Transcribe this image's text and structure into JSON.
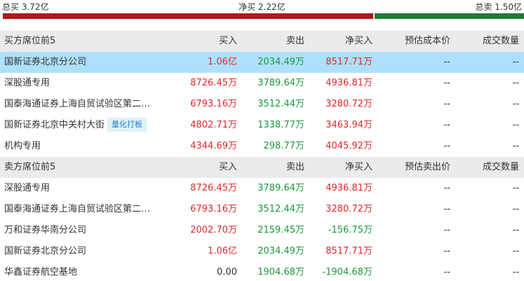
{
  "summary": {
    "total_buy": "总买 3.72亿",
    "net_buy": "净买 2.22亿",
    "total_sell": "总卖 1.50亿",
    "buy_fraction": 0.713,
    "colors": {
      "buy": "#b01818",
      "sell": "#1f7a3a",
      "up": "#e5262c",
      "down": "#1a9a3a",
      "highlight": "#aee0fb"
    }
  },
  "buy_section": {
    "headers": [
      "买方席位前5",
      "买入",
      "卖出",
      "净买入",
      "预估成本价",
      "成交数量"
    ],
    "rows": [
      {
        "name": "国新证券北京分公司",
        "buy": "1.06亿",
        "sell": "2034.49万",
        "net": "8517.71万",
        "cost": "--",
        "vol": "--",
        "tag": ""
      },
      {
        "name": "深股通专用",
        "buy": "8726.45万",
        "sell": "3789.64万",
        "net": "4936.81万",
        "cost": "--",
        "vol": "--",
        "tag": ""
      },
      {
        "name": "国泰海通证券上海自贸试验区第二…",
        "buy": "6793.16万",
        "sell": "3512.44万",
        "net": "3280.72万",
        "cost": "--",
        "vol": "--",
        "tag": ""
      },
      {
        "name": "国新证券北京中关村大街",
        "buy": "4802.71万",
        "sell": "1338.77万",
        "net": "3463.94万",
        "cost": "--",
        "vol": "--",
        "tag": "量化打板"
      },
      {
        "name": "机构专用",
        "buy": "4344.69万",
        "sell": "298.77万",
        "net": "4045.92万",
        "cost": "--",
        "vol": "--",
        "tag": ""
      }
    ]
  },
  "sell_section": {
    "headers": [
      "卖方席位前5",
      "买入",
      "卖出",
      "净买入",
      "预估卖出价",
      "成交数量"
    ],
    "rows": [
      {
        "name": "深股通专用",
        "buy": "8726.45万",
        "sell": "3789.64万",
        "net": "4936.81万",
        "cost": "--",
        "vol": "--",
        "tag": ""
      },
      {
        "name": "国泰海通证券上海自贸试验区第二…",
        "buy": "6793.16万",
        "sell": "3512.44万",
        "net": "3280.72万",
        "cost": "--",
        "vol": "--",
        "tag": ""
      },
      {
        "name": "万和证券华南分公司",
        "buy": "2002.70万",
        "sell": "2159.45万",
        "net": "-156.75万",
        "cost": "--",
        "vol": "--",
        "tag": ""
      },
      {
        "name": "国新证券北京分公司",
        "buy": "1.06亿",
        "sell": "2034.49万",
        "net": "8517.71万",
        "cost": "--",
        "vol": "--",
        "tag": ""
      },
      {
        "name": "华鑫证券航空基地",
        "buy": "0.00",
        "sell": "1904.68万",
        "net": "-1904.68万",
        "cost": "--",
        "vol": "--",
        "tag": ""
      }
    ]
  }
}
